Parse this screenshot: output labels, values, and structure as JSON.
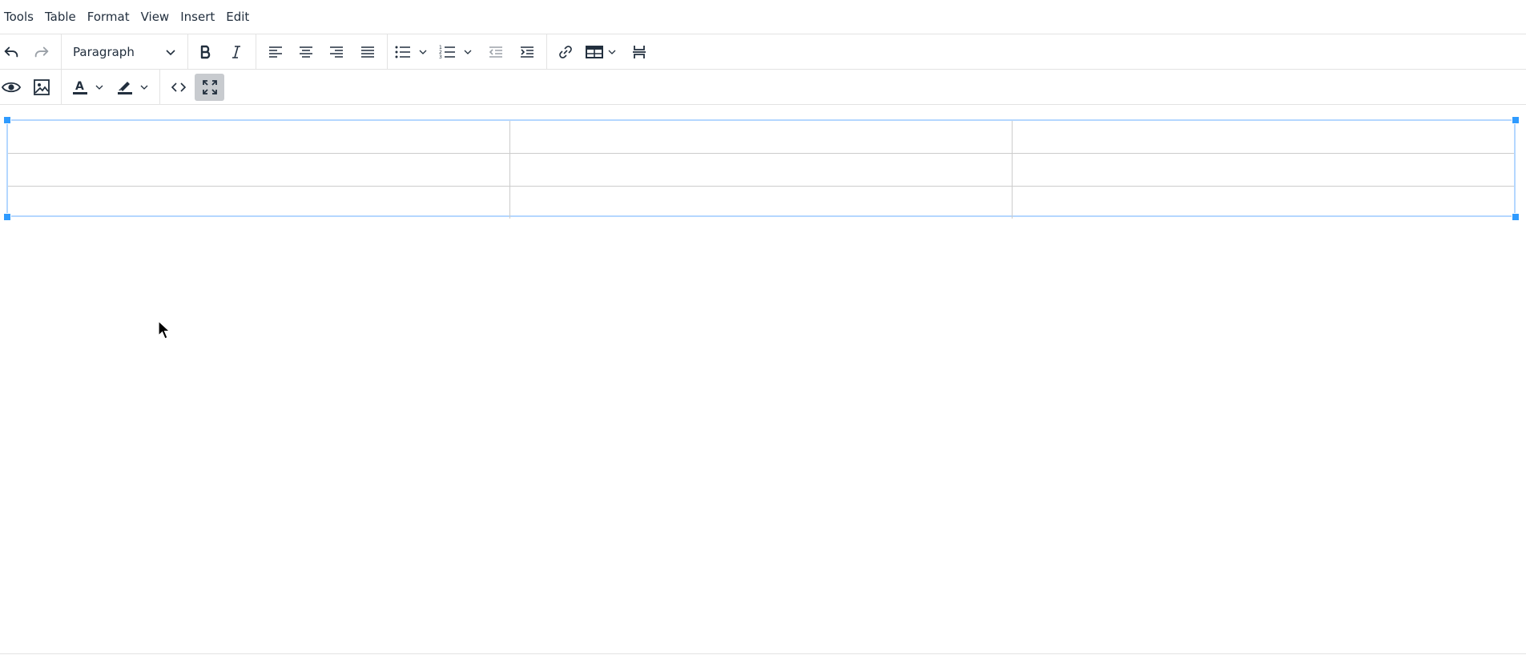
{
  "menubar": {
    "items": [
      "Tools",
      "Table",
      "Format",
      "View",
      "Insert",
      "Edit"
    ]
  },
  "toolbar": {
    "block_format": "Paragraph",
    "icons": {
      "undo": "undo-icon",
      "redo": "redo-icon",
      "bold": "bold-icon",
      "italic": "italic-icon",
      "align_left": "align-left-icon",
      "align_center": "align-center-icon",
      "align_right": "align-right-icon",
      "align_justify": "align-justify-icon",
      "bullet_list": "bullet-list-icon",
      "numbered_list": "numbered-list-icon",
      "outdent": "outdent-icon",
      "indent": "indent-icon",
      "link": "link-icon",
      "table": "table-icon",
      "page_break": "page-break-icon",
      "preview": "eye-icon",
      "image": "image-icon",
      "text_color": "text-color-icon",
      "highlight": "highlight-icon",
      "source_code": "code-icon",
      "fullscreen": "fullscreen-icon"
    },
    "active_tool": "fullscreen"
  },
  "content": {
    "table": {
      "rows": 3,
      "cols": 3,
      "cells": [
        [
          "",
          "",
          ""
        ],
        [
          "",
          "",
          ""
        ],
        [
          "",
          "",
          ""
        ]
      ],
      "selected": true
    }
  },
  "colors": {
    "selection_border": "#b4d7ff",
    "handle": "#2f9bff",
    "active_button": "#c8cbcf",
    "icon": "#222f3e"
  }
}
